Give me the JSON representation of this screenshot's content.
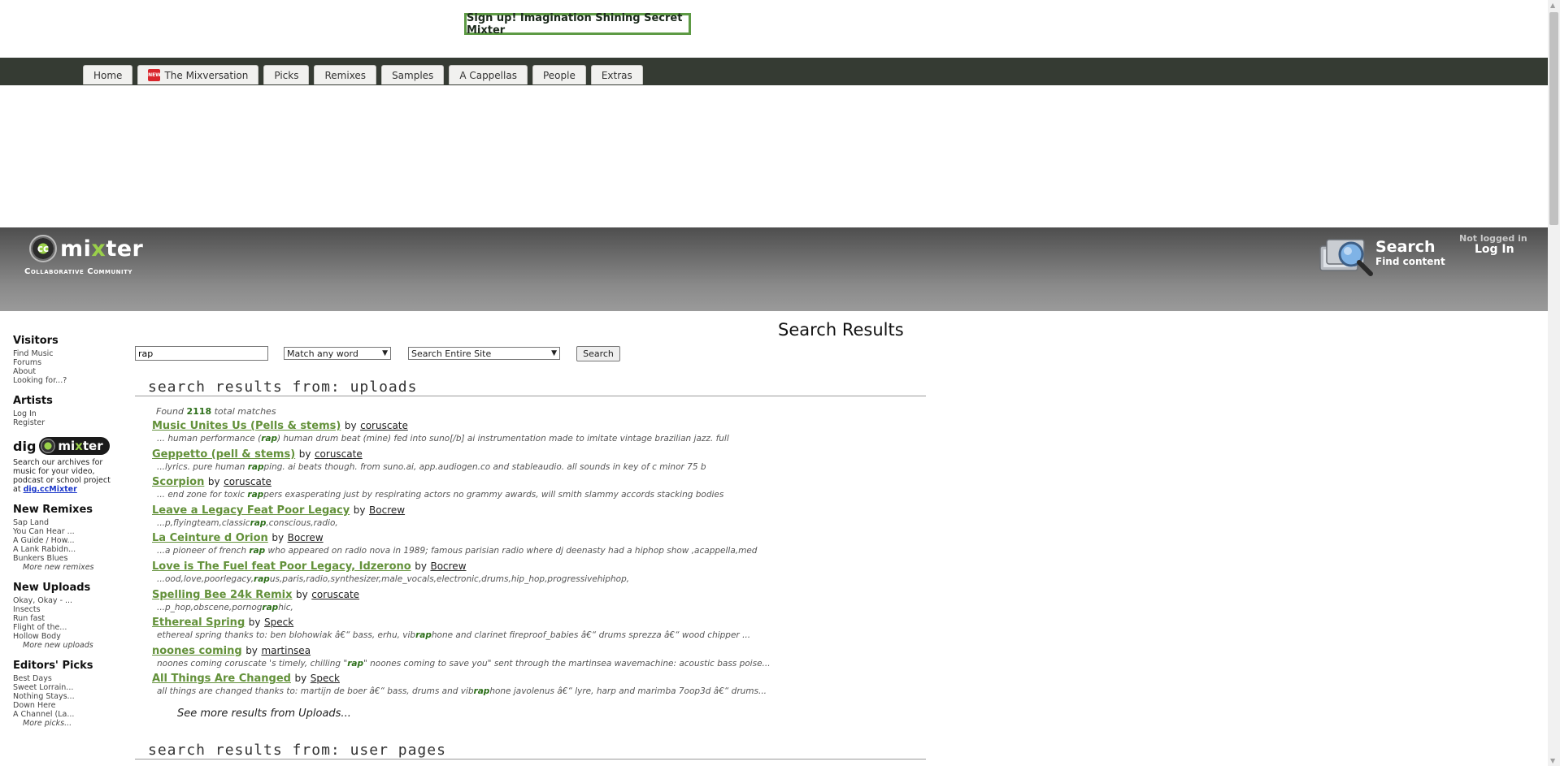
{
  "banner": {
    "signup_label": "Sign up! Imagination Shining Secret Mixter"
  },
  "tabs": [
    {
      "label": "Home",
      "badge": ""
    },
    {
      "label": "The Mixversation",
      "badge": "NEW"
    },
    {
      "label": "Picks",
      "badge": ""
    },
    {
      "label": "Remixes",
      "badge": ""
    },
    {
      "label": "Samples",
      "badge": ""
    },
    {
      "label": "A Cappellas",
      "badge": ""
    },
    {
      "label": "People",
      "badge": ""
    },
    {
      "label": "Extras",
      "badge": ""
    }
  ],
  "header": {
    "logo_prefix": "mi",
    "logo_accent": "x",
    "logo_suffix": "ter",
    "tagline": "Collaborative Community",
    "search_title": "Search",
    "search_sub": "Find content",
    "not_logged": "Not logged in",
    "login_label": "Log In"
  },
  "sidebar": {
    "visitors": {
      "title": "Visitors",
      "items": [
        "Find Music",
        "Forums",
        "About",
        "Looking for...?"
      ]
    },
    "artists": {
      "title": "Artists",
      "items": [
        "Log In",
        "Register"
      ]
    },
    "dig": {
      "word": "dig",
      "pill_prefix": "mi",
      "pill_accent": "x",
      "pill_suffix": "ter",
      "text": "Search our archives for music for your video, podcast or school project at",
      "link": "dig.ccMixter"
    },
    "new_remixes": {
      "title": "New Remixes",
      "items": [
        "Sap Land",
        "You Can Hear ...",
        "A Guide / How...",
        "A Lank Rabidn...",
        "Bunkers Blues"
      ],
      "more": "More new remixes"
    },
    "new_uploads": {
      "title": "New Uploads",
      "items": [
        "Okay, Okay - ...",
        "Insects",
        "Run fast",
        "Flight of the...",
        "Hollow Body"
      ],
      "more": "More new uploads"
    },
    "editors_picks": {
      "title": "Editors' Picks",
      "items": [
        "Best Days",
        "Sweet Lorrain...",
        "Nothing Stays...",
        "Down Here",
        "A Channel (La..."
      ],
      "more": "More picks..."
    }
  },
  "search": {
    "page_title": "Search Results",
    "query": "rap",
    "match_mode": "Match any word",
    "scope": "Search Entire Site",
    "button": "Search"
  },
  "uploads": {
    "heading": "search results from: uploads",
    "found_prefix": "Found",
    "found_count": "2118",
    "found_suffix": "total matches",
    "see_more": "See more results from Uploads...",
    "results": [
      {
        "title": "Music Unites Us (Pells & stems)",
        "by": "by",
        "user": "coruscate",
        "pre": "... human performance (",
        "hl": "rap",
        "post": ") human drum beat (mine) fed into suno[/b] ai instrumentation made to imitate vintage brazilian jazz. full"
      },
      {
        "title": "Geppetto (pell & stems)",
        "by": "by",
        "user": "coruscate",
        "pre": "...lyrics. pure human ",
        "hl": "rap",
        "post": "ping. ai beats though. from suno.ai, app.audiogen.co and stableaudio. all sounds in key of c minor 75 b"
      },
      {
        "title": "Scorpion",
        "by": "by",
        "user": "coruscate",
        "pre": "... end zone for toxic ",
        "hl": "rap",
        "post": "pers exasperating just by respirating actors no grammy awards, will smith slammy accords stacking bodies"
      },
      {
        "title": "Leave a Legacy Feat Poor Legacy",
        "by": "by",
        "user": "Bocrew",
        "pre": "...p,flyingteam,classic",
        "hl": "rap",
        "post": ",conscious,radio,"
      },
      {
        "title": "La Ceinture d Orion",
        "by": "by",
        "user": "Bocrew",
        "pre": "...a pioneer of french ",
        "hl": "rap",
        "post": " who appeared on radio nova in 1989; famous parisian radio where dj deenasty had a hiphop show ,acappella,med"
      },
      {
        "title": "Love is The Fuel feat Poor Legacy, Idzerono",
        "by": "by",
        "user": "Bocrew",
        "pre": "...ood,love,poorlegacy,",
        "hl": "rap",
        "post": "us,paris,radio,synthesizer,male_vocals,electronic,drums,hip_hop,progressivehiphop,"
      },
      {
        "title": "Spelling Bee 24k Remix",
        "by": "by",
        "user": "coruscate",
        "pre": "...p_hop,obscene,pornog",
        "hl": "rap",
        "post": "hic,"
      },
      {
        "title": "Ethereal Spring",
        "by": "by",
        "user": "Speck",
        "pre": "ethereal spring thanks to: ben blohowiak â€“ bass, erhu, vib",
        "hl": "rap",
        "post": "hone and clarinet fireproof_babies â€“ drums sprezza â€“ wood chipper ..."
      },
      {
        "title": "noones coming",
        "by": "by",
        "user": "martinsea",
        "pre": "noones coming coruscate 's timely, chilling \"",
        "hl": "rap",
        "post": "\" noones coming to save you\" sent through the martinsea wavemachine: acoustic bass poise..."
      },
      {
        "title": "All Things Are Changed",
        "by": "by",
        "user": "Speck",
        "pre": "all things are changed thanks to: martijn de boer â€“ bass, drums and vib",
        "hl": "rap",
        "post": "hone javolenus â€“ lyre, harp and marimba 7oop3d â€“ drums..."
      }
    ]
  },
  "user_pages": {
    "heading": "search results from: user pages"
  },
  "colors": {
    "accent_green": "#63913a",
    "highlight": "#2d6f1a",
    "nav_bar": "#353b33"
  }
}
